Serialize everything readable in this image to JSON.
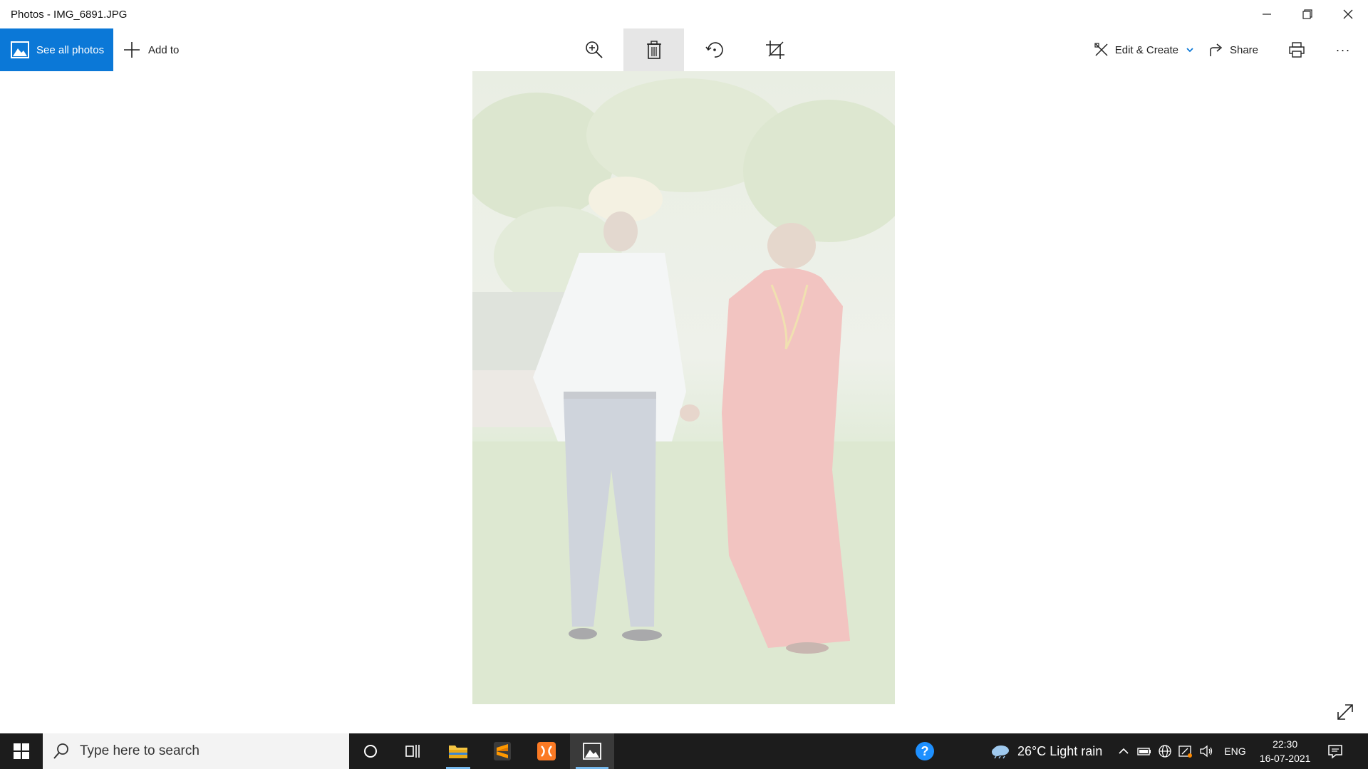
{
  "window": {
    "title": "Photos - IMG_6891.JPG"
  },
  "toolbar": {
    "see_all_label": "See all photos",
    "add_to_label": "Add to",
    "edit_create_label": "Edit & Create",
    "share_label": "Share",
    "more_label": "···"
  },
  "taskbar": {
    "search_placeholder": "Type here to search",
    "weather": "26°C  Light rain",
    "language": "ENG",
    "time": "22:30",
    "date": "16-07-2021"
  },
  "colors": {
    "accent": "#0b78d7",
    "taskbar_bg": "#1c1c1c",
    "active_tool_bg": "#e6e6e6"
  }
}
